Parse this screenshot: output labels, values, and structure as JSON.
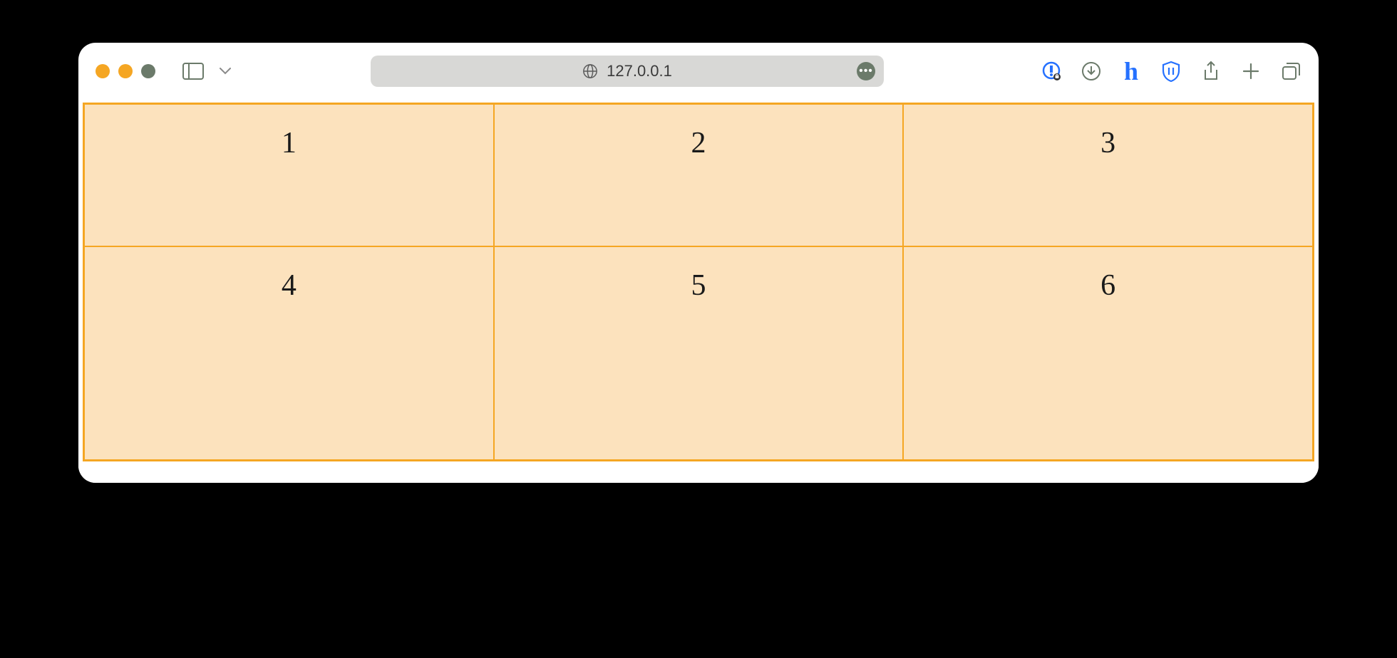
{
  "browser": {
    "url": "127.0.0.1"
  },
  "grid": {
    "cells": [
      "1",
      "2",
      "3",
      "4",
      "5",
      "6"
    ]
  }
}
